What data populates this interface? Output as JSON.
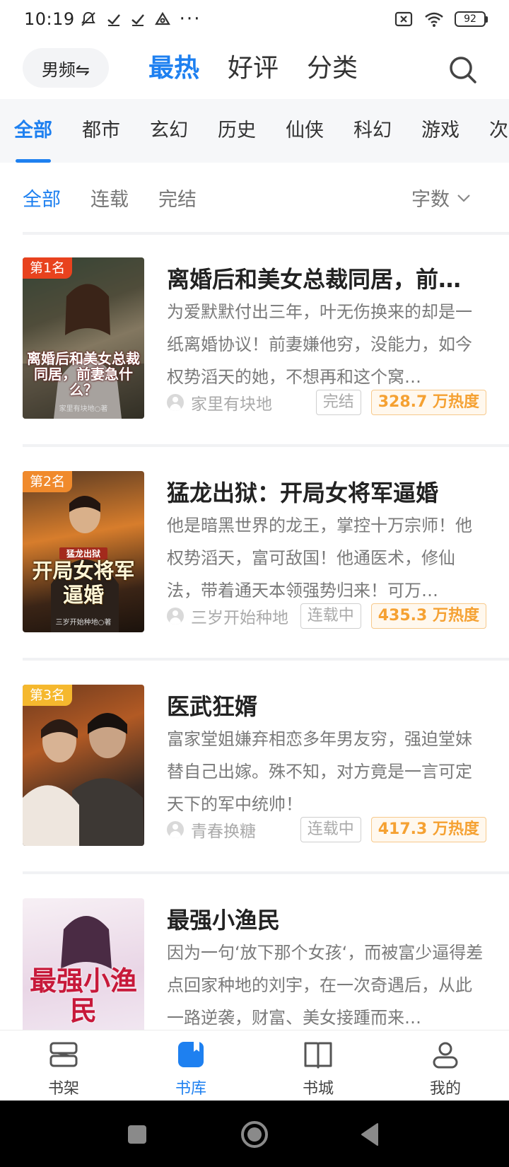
{
  "status_bar": {
    "time": "10:19",
    "more": "···",
    "battery": "92"
  },
  "top_nav": {
    "gender_switch": "男频⇋",
    "tabs": [
      "最热",
      "好评",
      "分类"
    ],
    "active_tab": "最热"
  },
  "categories": {
    "items": [
      "全部",
      "都市",
      "玄幻",
      "历史",
      "仙侠",
      "科幻",
      "游戏",
      "次"
    ],
    "active": "全部"
  },
  "filters": {
    "items": [
      "全部",
      "连载",
      "完结"
    ],
    "active": "全部",
    "sort_label": "字数"
  },
  "books": [
    {
      "rank": "第1名",
      "title": "离婚后和美女总裁同居，前…",
      "desc": "为爱默默付出三年，叶无伤换来的却是一纸离婚协议！前妻嫌他穷，没能力，如今权势滔天的她，不想再和这个窝…",
      "author": "家里有块地",
      "status": "完结",
      "heat": "328.7 万热度",
      "cover_text": "离婚后和美女总裁同居，前妻急什么？",
      "cover_author": "家里有块地○著",
      "badge_color": "#e8421e"
    },
    {
      "rank": "第2名",
      "title": "猛龙出狱：开局女将军逼婚",
      "desc": "他是暗黑世界的龙王，掌控十万宗师！他权势滔天，富可敌国！他通医术，修仙法，带着通天本领强势归来！可万…",
      "author": "三岁开始种地",
      "status": "连载中",
      "heat": "435.3 万热度",
      "cover_text": "开局女将军逼婚",
      "cover_subtitle": "猛龙出狱",
      "cover_author": "三岁开始种地○著",
      "badge_color": "#f08a2c"
    },
    {
      "rank": "第3名",
      "title": "医武狂婿",
      "desc": "富家堂姐嫌弃相恋多年男友穷，强迫堂妹替自己出嫁。殊不知，对方竟是一言可定天下的军中统帅！",
      "author": "青春换糖",
      "status": "连载中",
      "heat": "417.3 万热度",
      "badge_color": "#f5b82e"
    },
    {
      "title": "最强小渔民",
      "desc": "因为一句‘放下那个女孩‘，而被富少逼得差点回家种地的刘宇，在一次奇遇后，从此一路逆袭，财富、美女接踵而来…",
      "cover_text": "最强小渔民"
    }
  ],
  "tab_bar": {
    "items": [
      "书架",
      "书库",
      "书城",
      "我的"
    ],
    "active": "书库"
  },
  "colors": {
    "accent": "#1e80f0",
    "heat": "#f5a132"
  }
}
